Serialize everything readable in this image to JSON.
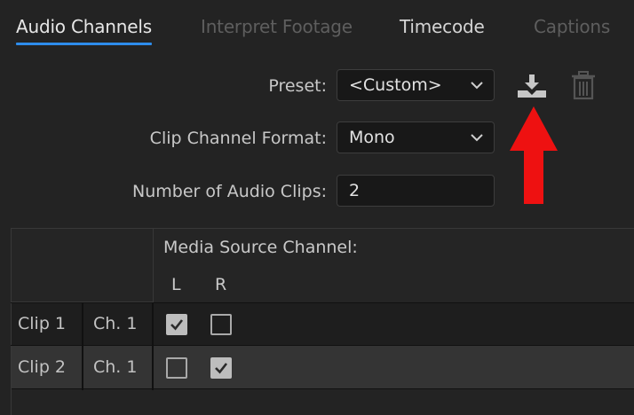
{
  "tabs": [
    {
      "label": "Audio Channels",
      "state": "active"
    },
    {
      "label": "Interpret Footage",
      "state": "disabled"
    },
    {
      "label": "Timecode",
      "state": "enabled"
    },
    {
      "label": "Captions",
      "state": "disabled"
    }
  ],
  "form": {
    "preset_label": "Preset:",
    "preset_value": "<Custom>",
    "clip_channel_format_label": "Clip Channel Format:",
    "clip_channel_format_value": "Mono",
    "number_of_audio_clips_label": "Number of Audio Clips:",
    "number_of_audio_clips_value": "2"
  },
  "icons": {
    "save_preset": "download-icon",
    "delete_preset": "trash-icon",
    "annotation": "red-arrow-up-icon"
  },
  "table": {
    "header": "Media Source Channel:",
    "channels": [
      "L",
      "R"
    ],
    "rows": [
      {
        "clip": "Clip 1",
        "channel": "Ch. 1",
        "L": true,
        "R": false
      },
      {
        "clip": "Clip 2",
        "channel": "Ch. 1",
        "L": false,
        "R": true
      }
    ]
  },
  "colors": {
    "accent": "#2d8ceb",
    "annotation_arrow": "#ee1111",
    "background": "#232323"
  }
}
